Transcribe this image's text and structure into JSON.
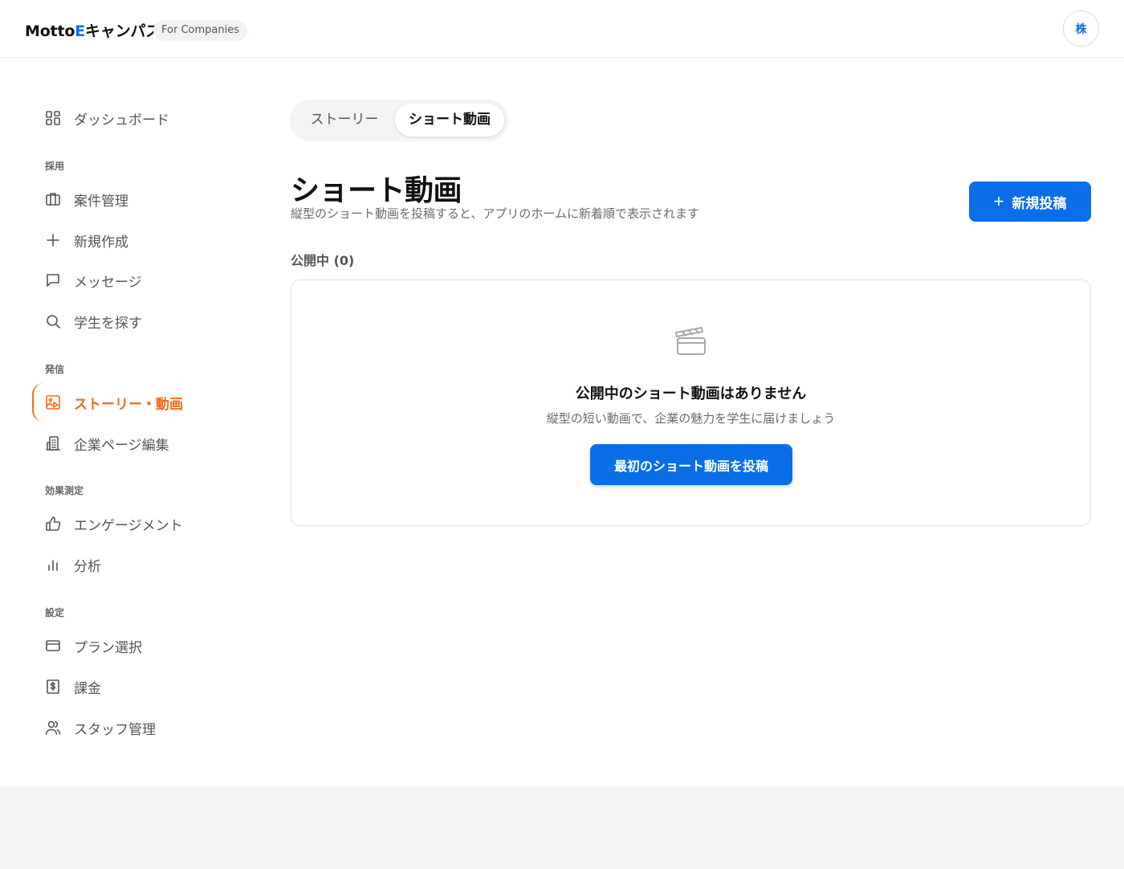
{
  "header": {
    "brand_prefix": "Motto",
    "brand_accent": "E",
    "brand_suffix": "キャンパス",
    "badge": "For Companies",
    "avatar_initial": "株"
  },
  "sidebar": {
    "sections": {
      "recruit": "採用",
      "publish": "発信",
      "metrics": "効果測定",
      "settings": "設定"
    },
    "items": {
      "dashboard": "ダッシュボード",
      "jobs": "案件管理",
      "new": "新規作成",
      "messages": "メッセージ",
      "students": "学生を探す",
      "stories": "ストーリー・動画",
      "company_page": "企業ページ編集",
      "engagement": "エンゲージメント",
      "analytics": "分析",
      "plan": "プラン選択",
      "billing": "課金",
      "staff": "スタッフ管理"
    },
    "active_item": "stories"
  },
  "main": {
    "tabs": {
      "story": "ストーリー",
      "short_video": "ショート動画",
      "selected": "short_video"
    },
    "title": "ショート動画",
    "subtitle": "縦型のショート動画を投稿すると、アプリのホームに新着順で表示されます",
    "new_post_button": "新規投稿",
    "published_label": "公開中 (0)",
    "empty": {
      "icon": "clapperboard-icon",
      "title": "公開中のショート動画はありません",
      "subtitle": "縦型の短い動画で、企業の魅力を学生に届けましょう",
      "cta": "最初のショート動画を投稿"
    }
  },
  "colors": {
    "accent_blue": "#0a6ee8",
    "active_orange": "#f26b1d",
    "footer_bg": "#f4f4f6"
  }
}
